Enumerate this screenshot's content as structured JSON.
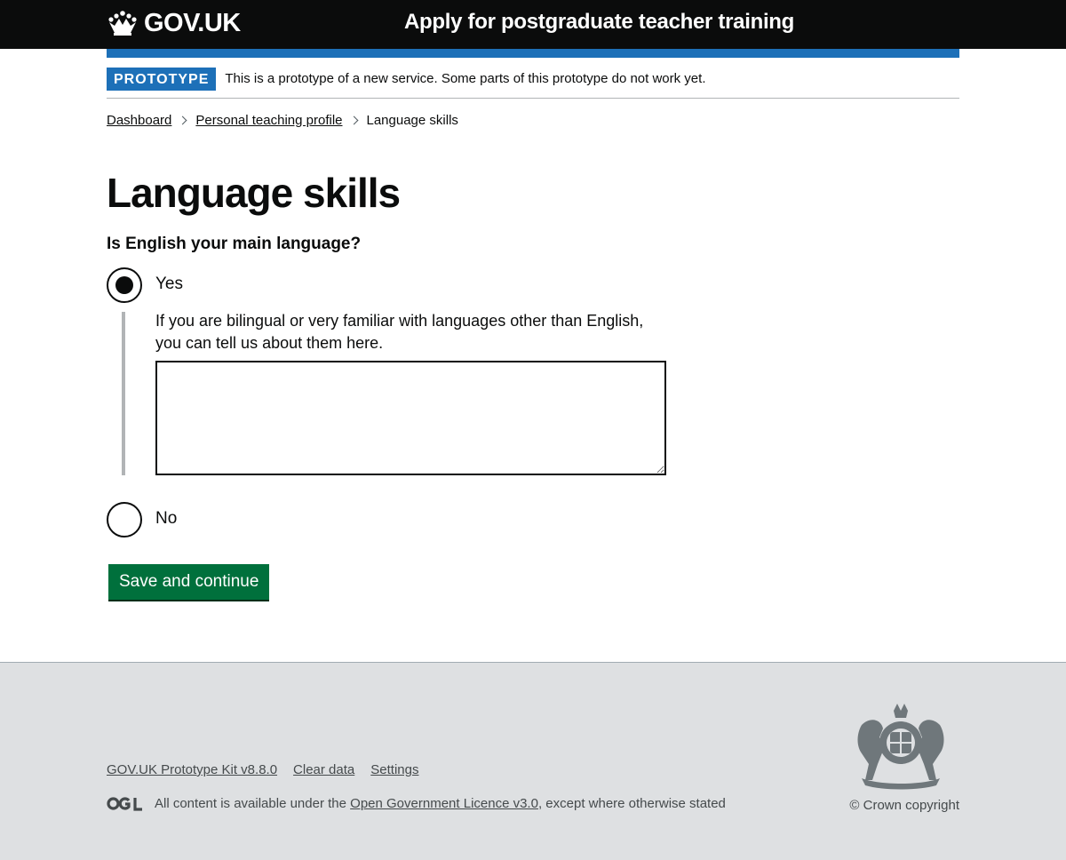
{
  "header": {
    "logo_text": "GOV.UK",
    "logo_icon": "crown-icon",
    "service_name": "Apply for postgraduate teacher training"
  },
  "phase_banner": {
    "tag": "PROTOTYPE",
    "text": "This is a prototype of a new service. Some parts of this prototype do not work yet."
  },
  "breadcrumbs": {
    "items": [
      {
        "label": "Dashboard"
      },
      {
        "label": "Personal teaching profile"
      }
    ],
    "current": "Language skills"
  },
  "page": {
    "title": "Language skills",
    "question": "Is English your main language?",
    "options": [
      {
        "label": "Yes",
        "checked": true
      },
      {
        "label": "No",
        "checked": false
      }
    ],
    "conditional_hint": "If you are bilingual or very familiar with languages other than English, you can tell us about them here.",
    "textarea_value": "",
    "submit_label": "Save and continue"
  },
  "footer": {
    "links": [
      {
        "label": "GOV.UK Prototype Kit v8.8.0"
      },
      {
        "label": "Clear data"
      },
      {
        "label": "Settings"
      }
    ],
    "licence_prefix": "All content is available under the",
    "licence_link": "Open Government Licence v3.0",
    "licence_suffix": ", except where otherwise stated",
    "copyright": "© Crown copyright"
  },
  "colors": {
    "header_bg": "#0b0c0c",
    "brand_blue": "#1d70b8",
    "button_green": "#00703c",
    "footer_bg": "#dee0e2"
  }
}
